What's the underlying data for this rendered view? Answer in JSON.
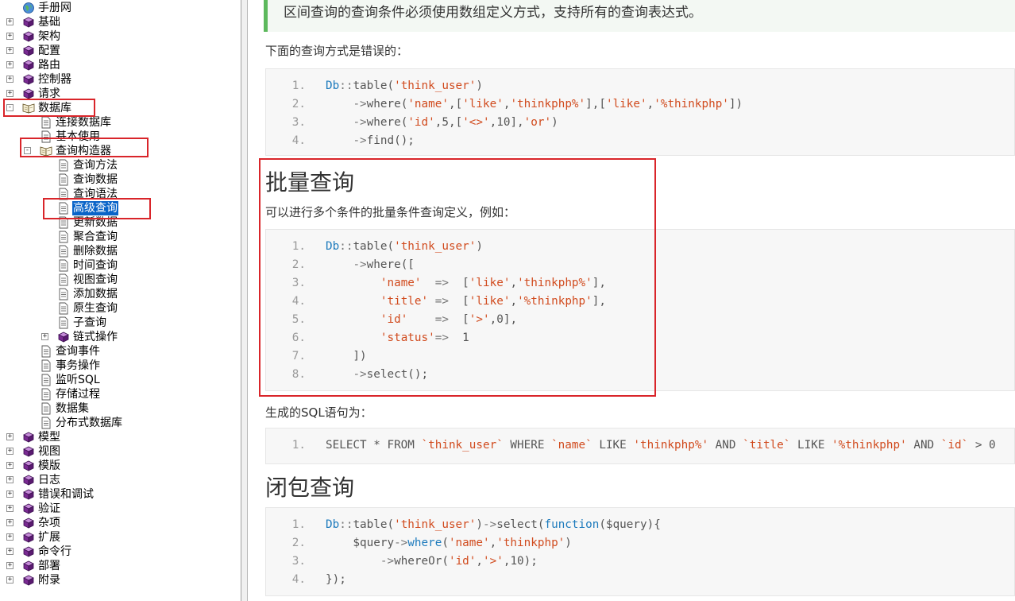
{
  "tree": [
    {
      "label": "手册网",
      "depth": 0,
      "expander": "",
      "icon": "globe",
      "selected": false
    },
    {
      "label": "基础",
      "depth": 0,
      "expander": "+",
      "icon": "book",
      "selected": false
    },
    {
      "label": "架构",
      "depth": 0,
      "expander": "+",
      "icon": "book",
      "selected": false
    },
    {
      "label": "配置",
      "depth": 0,
      "expander": "+",
      "icon": "book",
      "selected": false
    },
    {
      "label": "路由",
      "depth": 0,
      "expander": "+",
      "icon": "book",
      "selected": false
    },
    {
      "label": "控制器",
      "depth": 0,
      "expander": "+",
      "icon": "book",
      "selected": false
    },
    {
      "label": "请求",
      "depth": 0,
      "expander": "+",
      "icon": "book",
      "selected": false
    },
    {
      "label": "数据库",
      "depth": 0,
      "expander": "-",
      "icon": "open-book",
      "selected": false
    },
    {
      "label": "连接数据库",
      "depth": 1,
      "expander": "",
      "icon": "page",
      "selected": false
    },
    {
      "label": "基本使用",
      "depth": 1,
      "expander": "",
      "icon": "page",
      "selected": false
    },
    {
      "label": "查询构造器",
      "depth": 1,
      "expander": "-",
      "icon": "open-book",
      "selected": false
    },
    {
      "label": "查询方法",
      "depth": 2,
      "expander": "",
      "icon": "page",
      "selected": false
    },
    {
      "label": "查询数据",
      "depth": 2,
      "expander": "",
      "icon": "page",
      "selected": false
    },
    {
      "label": "查询语法",
      "depth": 2,
      "expander": "",
      "icon": "page",
      "selected": false
    },
    {
      "label": "高级查询",
      "depth": 2,
      "expander": "",
      "icon": "page",
      "selected": true
    },
    {
      "label": "更新数据",
      "depth": 2,
      "expander": "",
      "icon": "page",
      "selected": false
    },
    {
      "label": "聚合查询",
      "depth": 2,
      "expander": "",
      "icon": "page",
      "selected": false
    },
    {
      "label": "删除数据",
      "depth": 2,
      "expander": "",
      "icon": "page",
      "selected": false
    },
    {
      "label": "时间查询",
      "depth": 2,
      "expander": "",
      "icon": "page",
      "selected": false
    },
    {
      "label": "视图查询",
      "depth": 2,
      "expander": "",
      "icon": "page",
      "selected": false
    },
    {
      "label": "添加数据",
      "depth": 2,
      "expander": "",
      "icon": "page",
      "selected": false
    },
    {
      "label": "原生查询",
      "depth": 2,
      "expander": "",
      "icon": "page",
      "selected": false
    },
    {
      "label": "子查询",
      "depth": 2,
      "expander": "",
      "icon": "page",
      "selected": false
    },
    {
      "label": "链式操作",
      "depth": 2,
      "expander": "+",
      "icon": "book",
      "selected": false
    },
    {
      "label": "查询事件",
      "depth": 1,
      "expander": "",
      "icon": "page",
      "selected": false
    },
    {
      "label": "事务操作",
      "depth": 1,
      "expander": "",
      "icon": "page",
      "selected": false
    },
    {
      "label": "监听SQL",
      "depth": 1,
      "expander": "",
      "icon": "page",
      "selected": false
    },
    {
      "label": "存储过程",
      "depth": 1,
      "expander": "",
      "icon": "page",
      "selected": false
    },
    {
      "label": "数据集",
      "depth": 1,
      "expander": "",
      "icon": "page",
      "selected": false
    },
    {
      "label": "分布式数据库",
      "depth": 1,
      "expander": "",
      "icon": "page",
      "selected": false
    },
    {
      "label": "模型",
      "depth": 0,
      "expander": "+",
      "icon": "book",
      "selected": false
    },
    {
      "label": "视图",
      "depth": 0,
      "expander": "+",
      "icon": "book",
      "selected": false
    },
    {
      "label": "模版",
      "depth": 0,
      "expander": "+",
      "icon": "book",
      "selected": false
    },
    {
      "label": "日志",
      "depth": 0,
      "expander": "+",
      "icon": "book",
      "selected": false
    },
    {
      "label": "错误和调试",
      "depth": 0,
      "expander": "+",
      "icon": "book",
      "selected": false
    },
    {
      "label": "验证",
      "depth": 0,
      "expander": "+",
      "icon": "book",
      "selected": false
    },
    {
      "label": "杂项",
      "depth": 0,
      "expander": "+",
      "icon": "book",
      "selected": false
    },
    {
      "label": "扩展",
      "depth": 0,
      "expander": "+",
      "icon": "book",
      "selected": false
    },
    {
      "label": "命令行",
      "depth": 0,
      "expander": "+",
      "icon": "book",
      "selected": false
    },
    {
      "label": "部署",
      "depth": 0,
      "expander": "+",
      "icon": "book",
      "selected": false
    },
    {
      "label": "附录",
      "depth": 0,
      "expander": "+",
      "icon": "book",
      "selected": false
    }
  ],
  "colors": {
    "accent_green": "#5cb85c",
    "annotation_red": "#d9252a",
    "keyword": "#1e7bbd",
    "string": "#d14b1e",
    "selection": "#0a64c8"
  },
  "content": {
    "note": "区间查询的查询条件必须使用数组定义方式，支持所有的查询表达式。",
    "para_wrong": "下面的查询方式是错误的：",
    "code_wrong": [
      [
        {
          "t": "Db",
          "c": "kw"
        },
        {
          "t": "::",
          "c": "op"
        },
        {
          "t": "table("
        },
        {
          "t": "'think_user'",
          "c": "st"
        },
        {
          "t": ")"
        }
      ],
      [
        {
          "t": "    "
        },
        {
          "t": "->",
          "c": "op"
        },
        {
          "t": "where("
        },
        {
          "t": "'name'",
          "c": "st"
        },
        {
          "t": ",["
        },
        {
          "t": "'like'",
          "c": "st"
        },
        {
          "t": ","
        },
        {
          "t": "'thinkphp%'",
          "c": "st"
        },
        {
          "t": "],["
        },
        {
          "t": "'like'",
          "c": "st"
        },
        {
          "t": ","
        },
        {
          "t": "'%thinkphp'",
          "c": "st"
        },
        {
          "t": "])"
        }
      ],
      [
        {
          "t": "    "
        },
        {
          "t": "->",
          "c": "op"
        },
        {
          "t": "where("
        },
        {
          "t": "'id'",
          "c": "st"
        },
        {
          "t": ",5,["
        },
        {
          "t": "'<>'",
          "c": "st"
        },
        {
          "t": ",10],"
        },
        {
          "t": "'or'",
          "c": "st"
        },
        {
          "t": ")"
        }
      ],
      [
        {
          "t": "    "
        },
        {
          "t": "->",
          "c": "op"
        },
        {
          "t": "find();"
        }
      ]
    ],
    "h_batch": "批量查询",
    "para_batch": "可以进行多个条件的批量条件查询定义，例如：",
    "code_batch": [
      [
        {
          "t": "Db",
          "c": "kw"
        },
        {
          "t": "::",
          "c": "op"
        },
        {
          "t": "table("
        },
        {
          "t": "'think_user'",
          "c": "st"
        },
        {
          "t": ")"
        }
      ],
      [
        {
          "t": "    "
        },
        {
          "t": "->",
          "c": "op"
        },
        {
          "t": "where(["
        }
      ],
      [
        {
          "t": "        "
        },
        {
          "t": "'name'",
          "c": "st"
        },
        {
          "t": "  "
        },
        {
          "t": "=>",
          "c": "op"
        },
        {
          "t": "  ["
        },
        {
          "t": "'like'",
          "c": "st"
        },
        {
          "t": ","
        },
        {
          "t": "'thinkphp%'",
          "c": "st"
        },
        {
          "t": "],"
        }
      ],
      [
        {
          "t": "        "
        },
        {
          "t": "'title'",
          "c": "st"
        },
        {
          "t": " "
        },
        {
          "t": "=>",
          "c": "op"
        },
        {
          "t": "  ["
        },
        {
          "t": "'like'",
          "c": "st"
        },
        {
          "t": ","
        },
        {
          "t": "'%thinkphp'",
          "c": "st"
        },
        {
          "t": "],"
        }
      ],
      [
        {
          "t": "        "
        },
        {
          "t": "'id'",
          "c": "st"
        },
        {
          "t": "    "
        },
        {
          "t": "=>",
          "c": "op"
        },
        {
          "t": "  ["
        },
        {
          "t": "'>'",
          "c": "st"
        },
        {
          "t": ",0],"
        }
      ],
      [
        {
          "t": "        "
        },
        {
          "t": "'status'",
          "c": "st"
        },
        {
          "t": "=>",
          "c": "op"
        },
        {
          "t": "  1"
        }
      ],
      [
        {
          "t": "    ])"
        }
      ],
      [
        {
          "t": "    "
        },
        {
          "t": "->",
          "c": "op"
        },
        {
          "t": "select();"
        }
      ]
    ],
    "para_sql": "生成的SQL语句为：",
    "code_sql": [
      [
        {
          "t": "SELECT * FROM "
        },
        {
          "t": "`think_user`",
          "c": "st"
        },
        {
          "t": " WHERE "
        },
        {
          "t": "`name`",
          "c": "st"
        },
        {
          "t": " LIKE "
        },
        {
          "t": "'thinkphp%'",
          "c": "st"
        },
        {
          "t": " AND "
        },
        {
          "t": "`title`",
          "c": "st"
        },
        {
          "t": " LIKE "
        },
        {
          "t": "'%thinkphp'",
          "c": "st"
        },
        {
          "t": " AND "
        },
        {
          "t": "`id`",
          "c": "st"
        },
        {
          "t": " > 0"
        }
      ]
    ],
    "h_closure": "闭包查询",
    "code_closure": [
      [
        {
          "t": "Db",
          "c": "kw"
        },
        {
          "t": "::",
          "c": "op"
        },
        {
          "t": "table("
        },
        {
          "t": "'think_user'",
          "c": "st"
        },
        {
          "t": ")"
        },
        {
          "t": "->",
          "c": "op"
        },
        {
          "t": "select("
        },
        {
          "t": "function",
          "c": "kw"
        },
        {
          "t": "($query){"
        }
      ],
      [
        {
          "t": "    $query"
        },
        {
          "t": "->",
          "c": "op"
        },
        {
          "t": "where",
          "c": "kw"
        },
        {
          "t": "("
        },
        {
          "t": "'name'",
          "c": "st"
        },
        {
          "t": ","
        },
        {
          "t": "'thinkphp'",
          "c": "st"
        },
        {
          "t": ")"
        }
      ],
      [
        {
          "t": "        "
        },
        {
          "t": "->",
          "c": "op"
        },
        {
          "t": "whereOr("
        },
        {
          "t": "'id'",
          "c": "st"
        },
        {
          "t": ","
        },
        {
          "t": "'>'",
          "c": "st"
        },
        {
          "t": ",10);"
        }
      ],
      [
        {
          "t": "});"
        }
      ]
    ]
  }
}
